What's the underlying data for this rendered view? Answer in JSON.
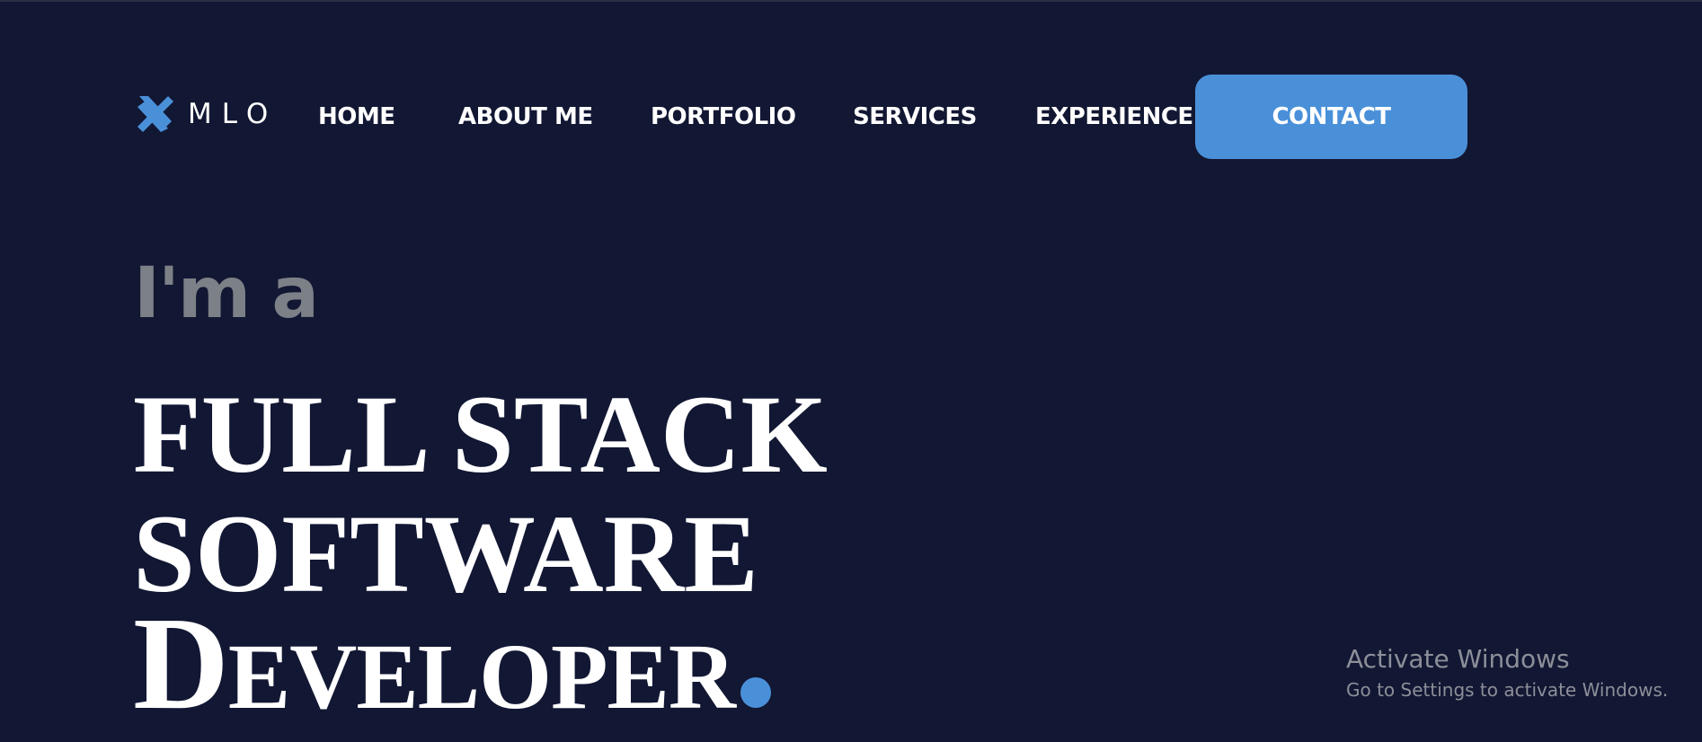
{
  "brand": {
    "logo_text": "MLO",
    "icon": "x-stripes-logo-icon",
    "accent_color": "#4a90d9"
  },
  "nav": {
    "items": [
      {
        "label": "HOME"
      },
      {
        "label": "ABOUT ME"
      },
      {
        "label": "PORTFOLIO"
      },
      {
        "label": "SERVICES"
      },
      {
        "label": "EXPERIENCE"
      }
    ],
    "contact_label": "CONTACT"
  },
  "hero": {
    "intro": "I'm a",
    "line1": "FULL STACK",
    "line2": "SOFTWARE",
    "line3": "Developer"
  },
  "watermark": {
    "title": "Activate Windows",
    "subtitle": "Go to Settings to activate Windows."
  },
  "colors": {
    "background": "#121733",
    "text": "#ffffff",
    "muted": "#7c8087",
    "accent": "#4a90d9"
  }
}
